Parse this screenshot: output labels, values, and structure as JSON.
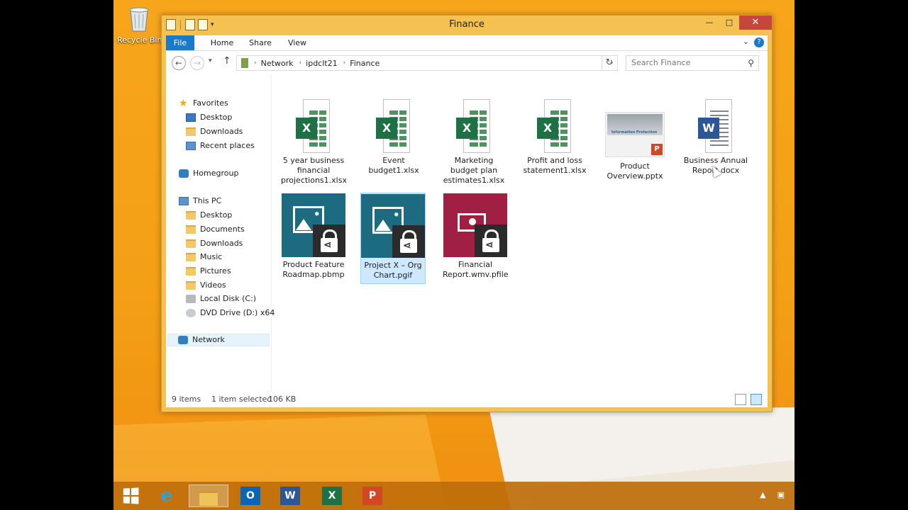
{
  "desktop": {
    "recycle_bin_label": "Recycle Bin"
  },
  "window": {
    "title": "Finance",
    "controls": {
      "minimize": "—",
      "maximize": "□",
      "close": "✕"
    }
  },
  "ribbon": {
    "tabs": [
      "File",
      "Home",
      "Share",
      "View"
    ],
    "help": "?"
  },
  "address": {
    "crumbs": [
      "Network",
      "ipdclt21",
      "Finance"
    ],
    "search_placeholder": "Search Finance"
  },
  "nav": {
    "favorites": "Favorites",
    "favorites_items": [
      "Desktop",
      "Downloads",
      "Recent places"
    ],
    "homegroup": "Homegroup",
    "this_pc": "This PC",
    "this_pc_items": [
      "Desktop",
      "Documents",
      "Downloads",
      "Music",
      "Pictures",
      "Videos",
      "Local Disk (C:)",
      "DVD Drive (D:) x64"
    ],
    "network": "Network"
  },
  "files": [
    {
      "name": "5 year business financial projections1.xlsx",
      "kind": "excel"
    },
    {
      "name": "Event budget1.xlsx",
      "kind": "excel"
    },
    {
      "name": "Marketing budget plan estimates1.xlsx",
      "kind": "excel"
    },
    {
      "name": "Profit and loss statement1.xlsx",
      "kind": "excel"
    },
    {
      "name": "Product Overview.pptx",
      "kind": "powerpoint"
    },
    {
      "name": "Business Annual Report.docx",
      "kind": "word"
    },
    {
      "name": "Product Feature Roadmap.pbmp",
      "kind": "protected-image"
    },
    {
      "name": "Project X – Org Chart.pgif",
      "kind": "protected-image",
      "selected": true
    },
    {
      "name": "Financial Report.wmv.pfile",
      "kind": "protected-video"
    }
  ],
  "badges": {
    "excel": "X",
    "word": "W",
    "powerpoint": "P",
    "slide_caption": "Information Protection"
  },
  "status": {
    "count": "9 items",
    "selection": "1 item selected",
    "size": "106 KB"
  },
  "taskbar": {
    "apps": [
      "start",
      "internet-explorer",
      "file-explorer",
      "outlook",
      "word",
      "excel",
      "powerpoint"
    ],
    "labels": {
      "outlook": "O",
      "word": "W",
      "excel": "X",
      "powerpoint": "P"
    }
  },
  "colors": {
    "accent": "#1979ca",
    "excel": "#1e7145",
    "word": "#2b5797",
    "powerpoint": "#d24726",
    "protected_tile": "#1c6b80",
    "protected_video": "#a01f43",
    "desktop": "#f4a017"
  }
}
